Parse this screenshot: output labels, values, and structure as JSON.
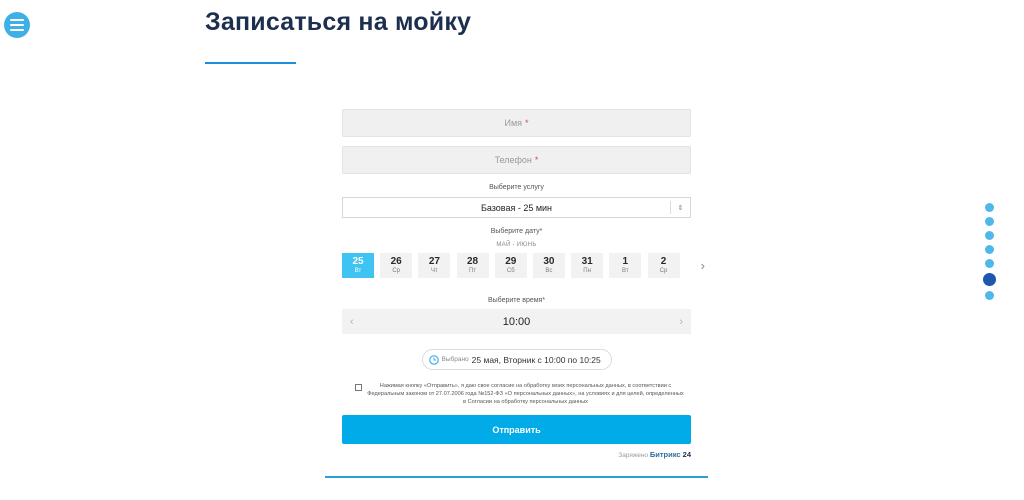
{
  "header": {
    "title": "Записаться на мойку"
  },
  "form": {
    "name_placeholder": "Имя",
    "phone_placeholder": "Телефон",
    "required_mark": "*",
    "service_label": "Выберите услугу",
    "service_value": "Базовая - 25 мин",
    "date_label": "Выберите дату*",
    "month_label": "МАЙ - ИЮНЬ",
    "days": [
      {
        "num": "25",
        "dow": "Вт",
        "selected": true
      },
      {
        "num": "26",
        "dow": "Ср",
        "selected": false
      },
      {
        "num": "27",
        "dow": "Чт",
        "selected": false
      },
      {
        "num": "28",
        "dow": "Пт",
        "selected": false
      },
      {
        "num": "29",
        "dow": "Сб",
        "selected": false
      },
      {
        "num": "30",
        "dow": "Вс",
        "selected": false
      },
      {
        "num": "31",
        "dow": "Пн",
        "selected": false
      },
      {
        "num": "1",
        "dow": "Вт",
        "selected": false
      },
      {
        "num": "2",
        "dow": "Ср",
        "selected": false
      }
    ],
    "time_label": "Выберите время*",
    "time_value": "10:00",
    "selected_label": "Выбрано",
    "selected_value": "25 мая, Вторник с 10:00 по 10:25",
    "consent_text": "Нажимая кнопку «Отправить», я даю свое согласие на обработку моих персональных данных, в соответствии с Федеральным законом от 27.07.2006 года №152-ФЗ «О персональных данных», на условиях и для целей, определенных в Согласии на обработку персональных данных",
    "submit_label": "Отправить"
  },
  "footer": {
    "powered_label": "Заряжено",
    "brand_name": "Битрикс",
    "brand_num": "24"
  },
  "side_nav": {
    "dot_count": 7,
    "active_index": 5
  },
  "colors": {
    "accent": "#00abe8",
    "selected_day": "#3fc3f2",
    "title": "#1d2f4f",
    "active_dot": "#1e57b0"
  }
}
